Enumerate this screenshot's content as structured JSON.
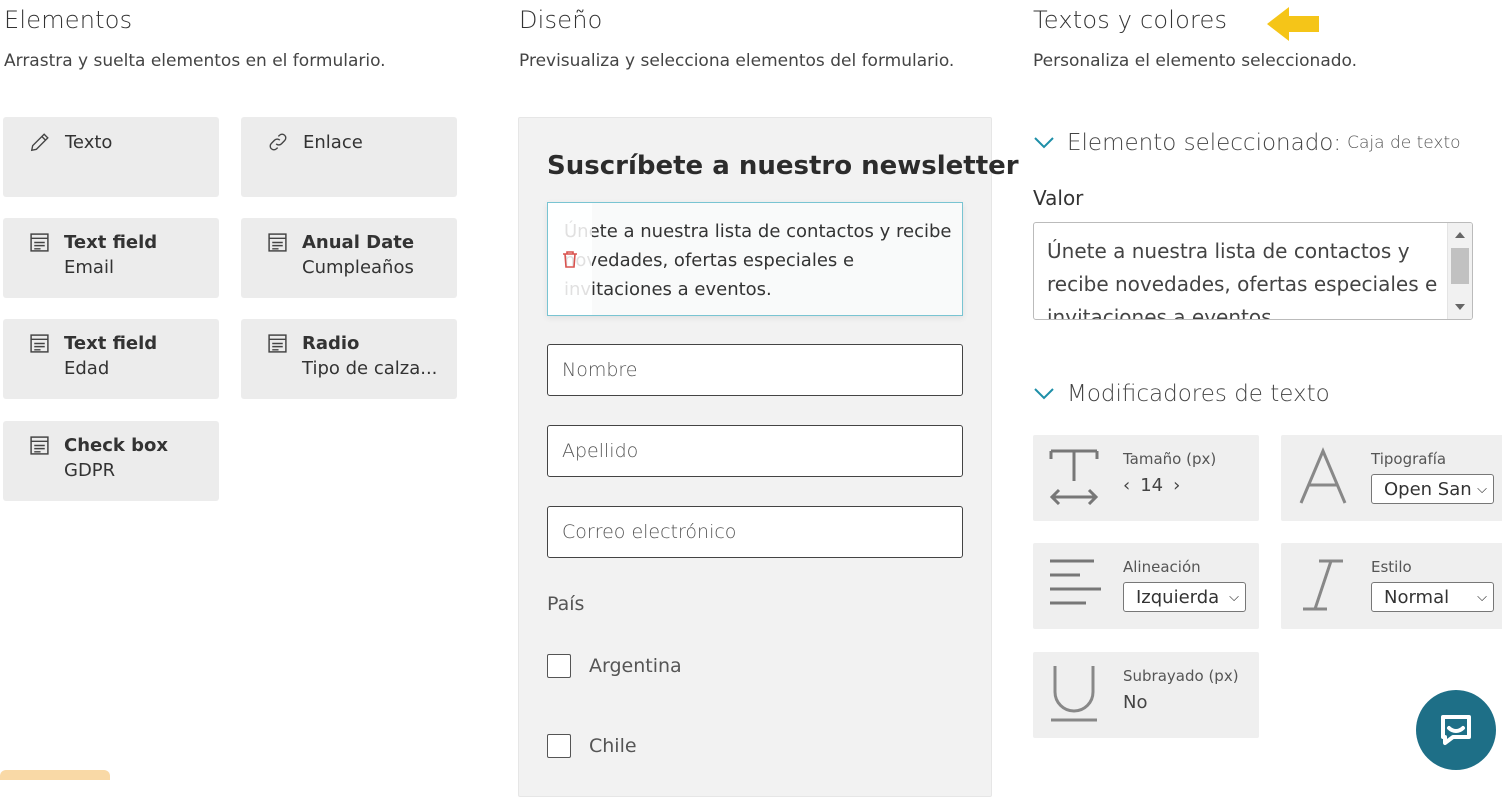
{
  "columns": {
    "elements": {
      "title": "Elementos",
      "subtitle": "Arrastra y suelta elementos en el formulario.",
      "items": [
        {
          "label": "Texto",
          "sub": "",
          "icon": "pencil-icon"
        },
        {
          "label": "Enlace",
          "sub": "",
          "icon": "link-icon"
        },
        {
          "label": "Text field",
          "sub": "Email",
          "icon": "form-field-icon"
        },
        {
          "label": "Anual Date",
          "sub": "Cumpleaños",
          "icon": "form-field-icon"
        },
        {
          "label": "Text field",
          "sub": "Edad",
          "icon": "form-field-icon"
        },
        {
          "label": "Radio",
          "sub": "Tipo de calza...",
          "icon": "form-field-icon"
        },
        {
          "label": "Check box",
          "sub": "GDPR",
          "icon": "form-field-icon"
        }
      ]
    },
    "design": {
      "title": "Diseño",
      "subtitle": "Previsualiza y selecciona elementos del formulario.",
      "form": {
        "heading": "Suscríbete a nuestro newsletter",
        "selected_text": "Únete a nuestra lista de contactos y recibe novedades, ofertas especiales e invitaciones a eventos.",
        "fields": [
          "Nombre",
          "Apellido",
          "Correo electrónico"
        ],
        "country_label": "País",
        "countries": [
          "Argentina",
          "Chile"
        ]
      }
    },
    "texts": {
      "title": "Textos y colores",
      "subtitle": "Personaliza el elemento seleccionado.",
      "selected_section": {
        "label": "Elemento seleccionado:",
        "value": "Caja de texto"
      },
      "valor_label": "Valor",
      "valor_text": "Únete a nuestra lista de contactos y recibe novedades, ofertas especiales e invitaciones a eventos.",
      "modifiers_label": "Modificadores de texto",
      "modifiers": {
        "size": {
          "label": "Tamaño (px)",
          "value": "14"
        },
        "font": {
          "label": "Tipografía",
          "value": "Open Sans"
        },
        "align": {
          "label": "Alineación",
          "value": "Izquierda"
        },
        "style": {
          "label": "Estilo",
          "value": "Normal"
        },
        "underline": {
          "label": "Subrayado (px)",
          "value": "No"
        }
      }
    }
  },
  "colors": {
    "accent_teal": "#1e6f87",
    "highlight_arrow": "#f5c518",
    "trash_red": "#d9534f"
  }
}
